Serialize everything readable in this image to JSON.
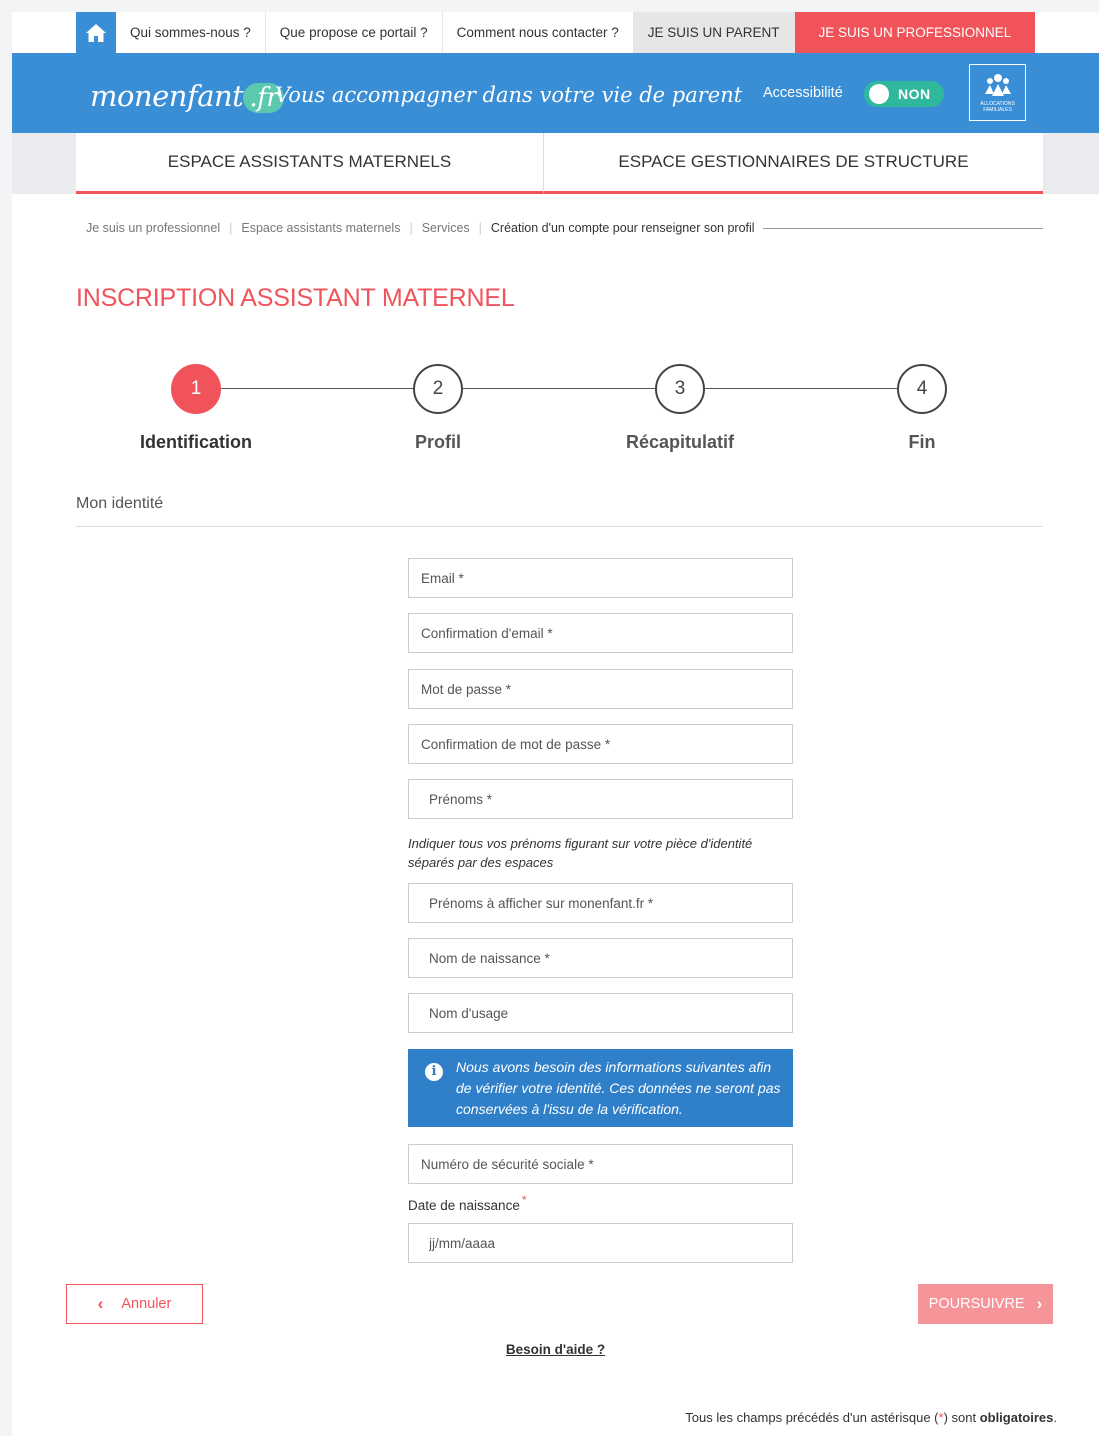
{
  "topnav": {
    "items": [
      "Qui sommes-nous ?",
      "Que propose ce portail ?",
      "Comment nous contacter ?"
    ],
    "parent": "JE SUIS UN PARENT",
    "professional": "JE SUIS UN PROFESSIONNEL"
  },
  "banner": {
    "logo_main": "monenfant",
    "logo_suffix": ".fr",
    "tagline": "Vous accompagner dans votre vie de parent",
    "accessibility_label": "Accessibilité",
    "toggle_value": "NON",
    "caf_text": "ALLOCATIONS FAMILIALES"
  },
  "spaces": {
    "tab1": "ESPACE ASSISTANTS MATERNELS",
    "tab2": "ESPACE GESTIONNAIRES DE STRUCTURE"
  },
  "breadcrumb": [
    "Je suis un professionnel",
    "Espace assistants maternels",
    "Services",
    "Création d'un compte pour renseigner son profil"
  ],
  "title": "INSCRIPTION ASSISTANT MATERNEL",
  "steps": [
    {
      "num": "1",
      "label": "Identification"
    },
    {
      "num": "2",
      "label": "Profil"
    },
    {
      "num": "3",
      "label": "Récapitulatif"
    },
    {
      "num": "4",
      "label": "Fin"
    }
  ],
  "section_title": "Mon identité",
  "fields": {
    "email": "Email *",
    "email_confirm": "Confirmation d'email *",
    "password": "Mot de passe *",
    "password_confirm": "Confirmation de mot de passe *",
    "firstnames": "Prénoms *",
    "firstnames_hint": "Indiquer tous vos prénoms figurant sur votre pièce d'identité séparés par des espaces",
    "display_firstnames": "Prénoms à afficher sur monenfant.fr *",
    "birth_name": "Nom de naissance *",
    "usage_name": "Nom d'usage",
    "info": "Nous avons besoin des informations suivantes afin de vérifier votre identité. Ces données ne seront pas conservées à l'issu de la vérification.",
    "ssn": "Numéro de sécurité sociale *",
    "birthdate_label": "Date de naissance",
    "birthdate_placeholder": "jj/mm/aaaa"
  },
  "actions": {
    "cancel": "Annuler",
    "next": "POURSUIVRE",
    "help": "Besoin d'aide ?"
  },
  "footnote": {
    "before": "Tous les champs précédés d'un astérisque (",
    "ast": "*",
    "middle": ") sont ",
    "bold": "obligatoires",
    "end": "."
  },
  "colors": {
    "accent": "#f0545a",
    "brand_blue": "#3a8ed6",
    "toggle": "#2fb89c"
  }
}
